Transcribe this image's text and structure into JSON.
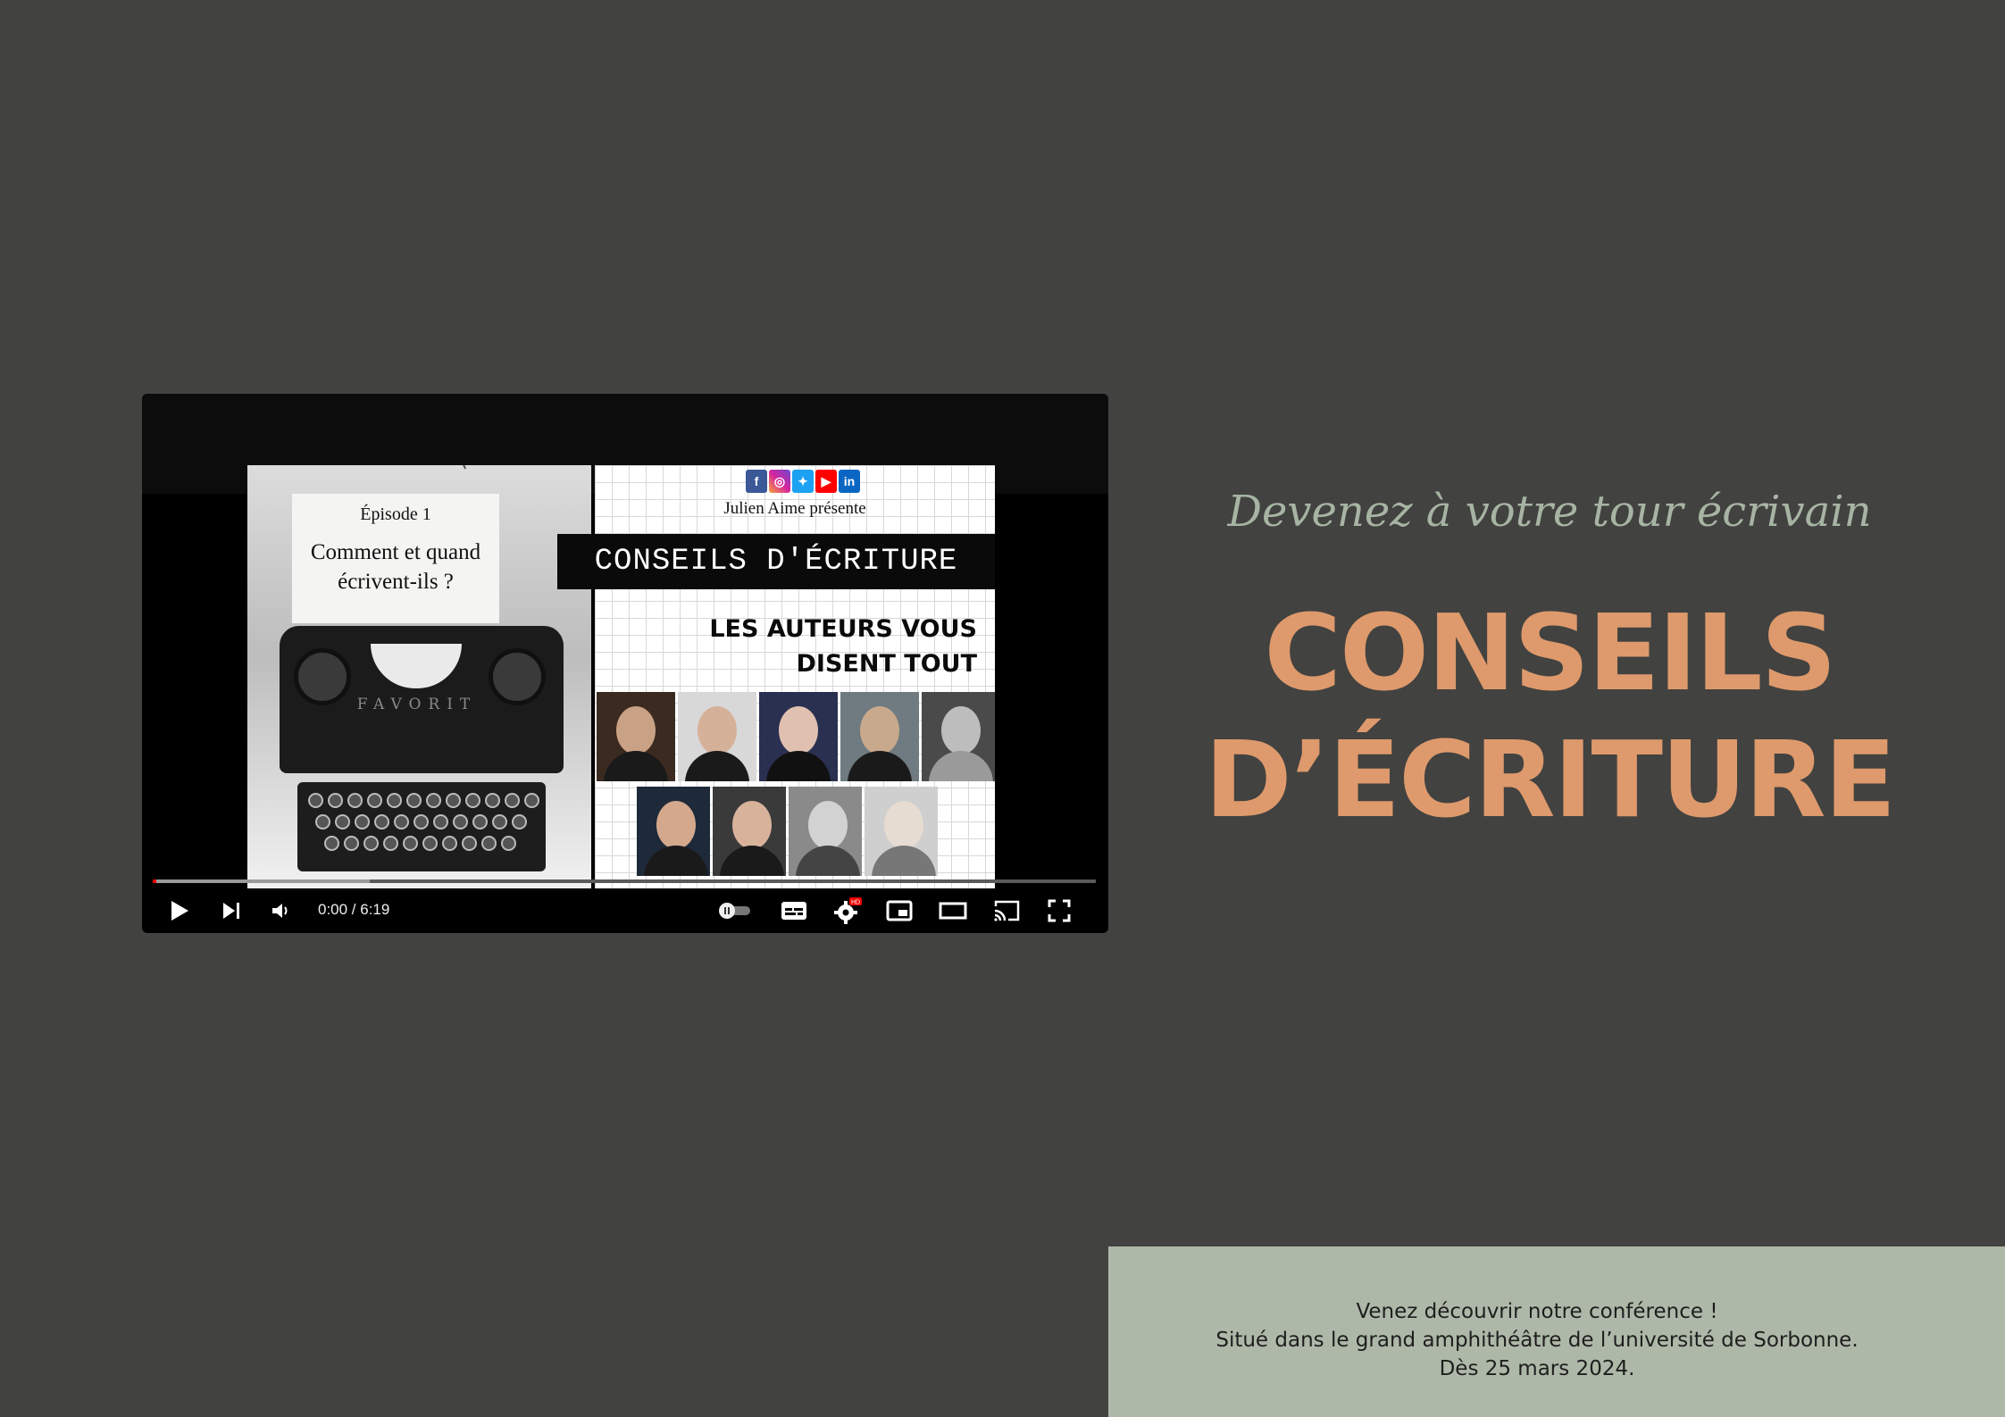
{
  "video": {
    "thumbnail": {
      "episode": "Épisode 1",
      "question": "Comment et quand écrivent-ils ?",
      "typewriter_brand": "FAVORIT",
      "presenter": "Julien Aime présente",
      "banner": "CONSEILS D'ÉCRITURE",
      "tagline": "LES AUTEURS VOUS DISENT TOUT",
      "social_icons": [
        "facebook-icon",
        "instagram-icon",
        "twitter-icon",
        "youtube-icon",
        "linkedin-icon"
      ]
    },
    "player": {
      "time": "0:00 / 6:19",
      "progress_loaded_fraction": 0.23,
      "quality_badge": "HD",
      "controls": [
        "play-icon",
        "next-icon",
        "volume-icon",
        "autoplay-toggle",
        "subtitles-icon",
        "settings-icon",
        "miniplayer-icon",
        "theater-icon",
        "cast-icon",
        "fullscreen-icon"
      ]
    }
  },
  "hero": {
    "kicker": "Devenez à votre tour écrivain",
    "title_line1": "CONSEILS",
    "title_line2": "D’ÉCRITURE"
  },
  "info": {
    "line1": "Venez découvrir notre conférence !",
    "line2": "Situé dans le grand amphithéâtre de l’université de Sorbonne.",
    "line3": "Dès 25 mars 2024."
  },
  "colors": {
    "background": "#424240",
    "accent": "#de9a6c",
    "kicker": "#a7b4a3",
    "info_panel": "#aeb8a8"
  }
}
